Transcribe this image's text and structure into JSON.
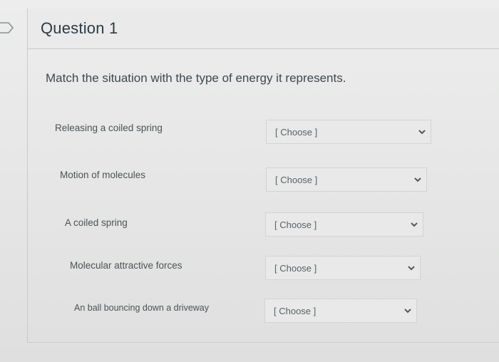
{
  "question": {
    "title": "Question 1",
    "prompt": "Match the situation with the type of energy it represents."
  },
  "rows": [
    {
      "label": "Releasing a coiled spring",
      "selected": "[ Choose ]"
    },
    {
      "label": "Motion of molecules",
      "selected": "[ Choose ]"
    },
    {
      "label": "A coiled spring",
      "selected": "[ Choose ]"
    },
    {
      "label": "Molecular attractive forces",
      "selected": "[ Choose ]"
    },
    {
      "label": "An ball bouncing down a driveway",
      "selected": "[ Choose ]"
    }
  ],
  "icons": {
    "flag": "flag-icon",
    "dropdown": "chevron-down-icon"
  },
  "colors": {
    "title": "#2d3b45",
    "chevron": "#4d5a63"
  }
}
